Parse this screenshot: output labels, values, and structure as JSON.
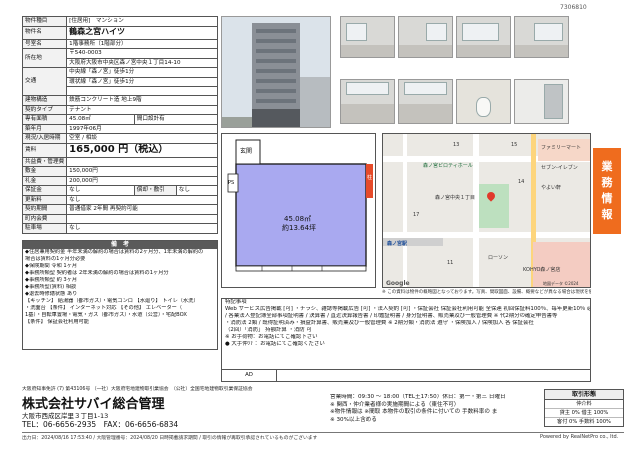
{
  "doc_number": "7306810",
  "property": {
    "type_label": "物件種目",
    "type_value": "[住居用]　マンション",
    "name_label": "物件名",
    "name_value": "鶴森之宮ハイツ",
    "room_label": "号室名",
    "room_value": "1階事務所（1階部分）",
    "addr_label": "所在地",
    "zip": "〒540-0003",
    "addr_value": "大阪府大阪市中央区森ノ宮中央１丁目14-10",
    "transit_label": "交通",
    "transit_1": "中央線「森ノ宮」徒歩1分",
    "transit_2": "環状線「森ノ宮」徒歩1分",
    "transit_3": "",
    "struct_label": "建物構造",
    "struct_value": "鉄筋コンクリート造 地上9階",
    "contract_label": "契約タイプ",
    "contract_value": "テナント",
    "area_label": "専有面積",
    "area_value": "45.08㎡",
    "layout_value": "間口設計有",
    "built_label": "築年月",
    "built_value": "1997年06月",
    "status_label": "現況/入居時期",
    "status_value": "空室 / 相談",
    "rent_label": "賃料",
    "rent_value": "165,000 円（税込）",
    "common_label": "共益費・管理費",
    "common_value": "",
    "deposit_label": "敷金",
    "deposit_value": "150,000円",
    "key_label": "礼金",
    "key_value": "200,000円",
    "guarantee_label": "保証金",
    "guarantee_value": "なし",
    "amort_label": "償却・敷引",
    "amort_value": "なし",
    "renew_label": "更新料",
    "renew_value": "なし",
    "period_label": "契約期間",
    "period_value": "普通借家 2年間 再契約可能",
    "insurance_label": "町内会費",
    "insurance_value": "",
    "parking_label": "駐車場",
    "parking_value": "なし"
  },
  "remarks": {
    "title": "備　考",
    "lines": [
      "◆住居兼用契約金 半年未満の解約の場合は賃料の2ヶ月分、1年未満の解約の",
      "場合は賃料の1ヶ月分必要",
      "◆保険期間 令和 1ヶ月",
      "◆事務所類型 契約者は 2年未満の解約の場合は賃料の1ヶ月分",
      "◆事務所類型 約 3ヶ月",
      "◆事務所型(賃料) 相談",
      "◆退去時修繕状態 あり",
      "【キッチン】 給湯器（都市ガス）・電気コンロ 【水廻り】 トイレ（水洗）",
      "・洗面台 【条件】 インターネット対応 【その他】 エレベーター（",
      "1基）・自転車置場・電気・ガス（都市ガス）・水道（公営）・宅配BOX",
      "",
      "【条件】 保証会社利用可能"
    ]
  },
  "floor_plan": {
    "area_text": "45.08㎡",
    "tsubo_text": "約13.64坪",
    "entrance": "玄関",
    "ps": "PS",
    "column": "柱"
  },
  "map": {
    "labels": [
      "森ノ宮ピロティホール",
      "森ノ宮駅",
      "森ノ宮中央１丁目",
      "やよい軒",
      "セブン-イレブン",
      "ローソン",
      "KOHYO森ノ宮店",
      "ファミリーマート",
      "17",
      "11",
      "14",
      "13",
      "15"
    ],
    "google": "Google",
    "copyright": "地図データ ©2024"
  },
  "side_badge": [
    "業",
    "務",
    "情",
    "報"
  ],
  "notice": "※ この資料は物件の概略図となっております。写真、間取図面、設備、概要などが異なる場合は現状を優先とします",
  "notes": {
    "lines": [
      "特記事項",
      "Web サービス広告掲載 [可] ・チラシ、雑誌等掲載広告 [可] ・法人契約 [可] ・保証会社 保証会社利用可能 全保連 初回保証料100％、毎年更新10％ 必要書類：",
      "/ 各業法人登記簿全部事項証明書 / 決算書 / 直近決算報告書 / 印鑑証明書 / 身分証明書、販売業及び一般管理費 ※ 代2期分の確定申告書等",
      "・消防法 2類 / 既得証明済み・損益計算書、販売業及び一般管理費 ※ 2期分類・消防法 遵守 ・保険加入 / 保険加入 各 保証会社",
      "（2回）「消防」 持額計算 ・消防 可",
      "※ お手荷物：お電話にてご確認下さい",
      "● 大手仲介 ：お電話にてご確認ください"
    ],
    "biko_label": "AD",
    "biko_value": ""
  },
  "footer": {
    "license": "大阪府知事免許 (7) 第43106号 （一社）大阪府宅地建物取引業協会　（公社）全国宅地建物取引業保証協会",
    "company": "株式会社サバイ総合管理",
    "address": "大阪市西成区岸里３丁目1-13",
    "phone": "TEL：06-6656-2935　FAX：06-6656-6834",
    "hours_1": "営業時間：09:30 ～ 18:00（TEL土17:50）休日：第一・第三 日曜日",
    "hours_2": "※ 関西・仲介業者様の実施期間による（東住不可）",
    "hours_3": "※物件情報は ※間取 本物件の取引の条件に付いての 手数料率の ま",
    "hours_4": "※ 30%以上含める",
    "fee_title": "取引形態",
    "fee_rows": [
      "仲介料",
      "貸主 0%  借主 100%",
      "客付 0%  手数料 100%"
    ],
    "printed": "出力日：2024/08/16 17:53:40 / 大阪管理番号：2024/08/20 日時掲載請求期間 / 取引の情報が再取引承認されているものがございます",
    "powered": "Powered by RealNetPro co., ltd."
  }
}
